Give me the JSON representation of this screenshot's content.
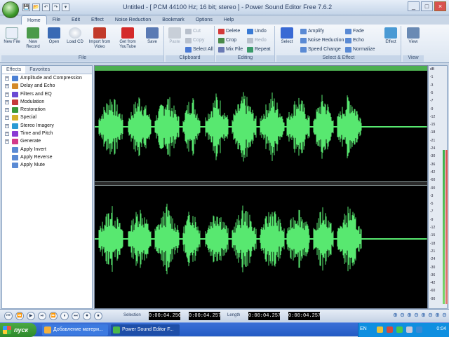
{
  "title_bar": {
    "title": "Untitled - [ PCM 44100 Hz; 16 bit; stereo ] - Power Sound Editor Free 7.6.2",
    "quick_access": [
      "💾",
      "📂",
      "↶",
      "↷",
      "▾"
    ],
    "controls": [
      "_",
      "□",
      "×"
    ]
  },
  "tabs": [
    "Home",
    "File",
    "Edit",
    "Effect",
    "Noise Reduction",
    "Bookmark",
    "Options",
    "Help"
  ],
  "ribbon": {
    "file": {
      "title": "File",
      "buttons": [
        "New File",
        "New Record",
        "Open",
        "Load CD",
        "Import from Video",
        "Get from YouTube",
        "Save"
      ]
    },
    "clipboard": {
      "title": "Clipboard",
      "paste": "Paste",
      "cut": "Cut",
      "copy": "Copy",
      "select_all": "Select All"
    },
    "editing": {
      "title": "Editing",
      "delete": "Delete",
      "undo": "Undo",
      "crop": "Crop",
      "redo": "Redo",
      "mix_file": "Mix File",
      "repeat": "Repeat"
    },
    "select_effect": {
      "title": "Select & Effect",
      "select": "Select",
      "amplify": "Amplify",
      "fade": "Fade",
      "noise_reduction": "Noise Reduction",
      "echo": "Echo",
      "speed_change": "Speed Change",
      "normalize": "Normalize",
      "effect": "Effect"
    },
    "view": {
      "title": "View",
      "view": "View"
    }
  },
  "left_panel": {
    "tabs": [
      "Effects",
      "Favorites"
    ],
    "items": [
      {
        "label": "Amplitude and Compression",
        "color": "#4a7fd4",
        "expander": "+"
      },
      {
        "label": "Delay and Echo",
        "color": "#d48a2a",
        "expander": "+"
      },
      {
        "label": "Filters and EQ",
        "color": "#6a4ad4",
        "expander": "+"
      },
      {
        "label": "Modulation",
        "color": "#c43a3a",
        "expander": "+"
      },
      {
        "label": "Restoration",
        "color": "#3a9a3a",
        "expander": "+"
      },
      {
        "label": "Special",
        "color": "#d4b02a",
        "expander": "+"
      },
      {
        "label": "Stereo Imagery",
        "color": "#2a9ad4",
        "expander": "+"
      },
      {
        "label": "Time and Pitch",
        "color": "#8a3ad4",
        "expander": "+"
      },
      {
        "label": "Generate",
        "color": "#d43a8a",
        "expander": "+"
      },
      {
        "label": "Apply Invert",
        "color": "#5a8ad4",
        "expander": ""
      },
      {
        "label": "Apply Reverse",
        "color": "#5a8ad4",
        "expander": ""
      },
      {
        "label": "Apply Mute",
        "color": "#5a8ad4",
        "expander": ""
      }
    ]
  },
  "meter": {
    "labels": [
      "dB",
      "-1",
      "-3",
      "-5",
      "-7",
      "-9",
      "-12",
      "-15",
      "-18",
      "-21",
      "-24",
      "-30",
      "-36",
      "-42",
      "-60",
      "-90",
      "-3",
      "-5",
      "-7",
      "-9",
      "-12",
      "-15",
      "-18",
      "-21",
      "-24",
      "-30",
      "-36",
      "-42",
      "-60",
      "-90"
    ]
  },
  "transport": {
    "buttons": [
      "⏮",
      "⏪",
      "▶",
      "⏯",
      "⏩",
      "⏸",
      "⏭",
      "⏺",
      "⏹"
    ],
    "selection_label": "Selection",
    "selection_start": "0:00:04.250",
    "selection_end": "0:00:04.257",
    "length_label": "Length",
    "length_start": "0:00:04.257",
    "length_end": "0:00:04.257",
    "zoom_buttons": [
      "⊕",
      "⊖",
      "⊕",
      "⊖",
      "⊕",
      "⊖",
      "⊕",
      "⊖"
    ]
  },
  "taskbar": {
    "start": "пуск",
    "tasks": [
      "Добавление матери...",
      "Power Sound Editor F..."
    ],
    "lang": "EN",
    "clock": "0:04"
  },
  "colors": {
    "wave": "#58e870",
    "ruler": "#4caf50"
  }
}
